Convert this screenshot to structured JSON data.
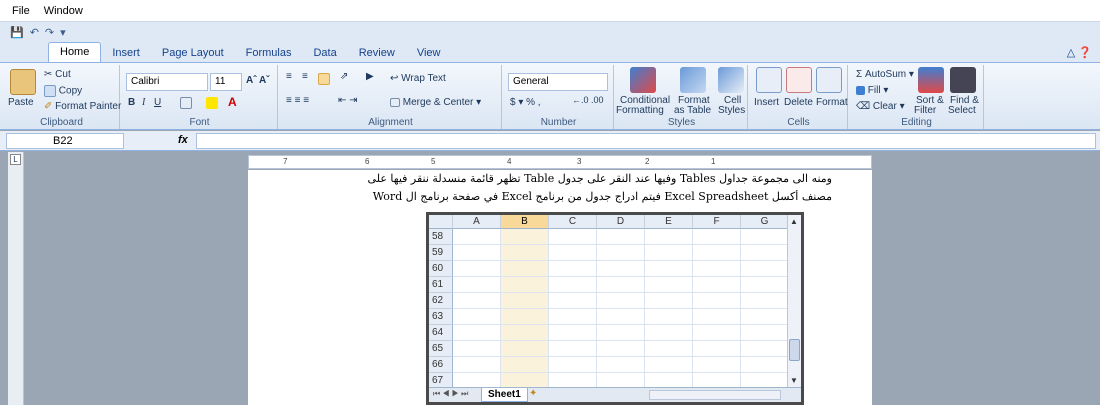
{
  "menu": {
    "items": [
      "File",
      "Window"
    ]
  },
  "ribbon": {
    "tabs": [
      "Home",
      "Insert",
      "Page Layout",
      "Formulas",
      "Data",
      "Review",
      "View"
    ],
    "active_tab": "Home",
    "clipboard": {
      "paste": "Paste",
      "cut": "Cut",
      "copy": "Copy",
      "format_painter": "Format Painter",
      "label": "Clipboard"
    },
    "font": {
      "name": "Calibri",
      "size": "11",
      "label": "Font"
    },
    "alignment": {
      "wrap": "Wrap Text",
      "merge": "Merge & Center",
      "label": "Alignment"
    },
    "number": {
      "format": "General",
      "label": "Number"
    },
    "styles": {
      "conditional": "Conditional",
      "conditional2": "Formatting",
      "format_as": "Format",
      "format_as2": "as Table",
      "cell": "Cell",
      "cell2": "Styles",
      "label": "Styles"
    },
    "cells": {
      "insert": "Insert",
      "delete": "Delete",
      "format": "Format",
      "label": "Cells"
    },
    "editing": {
      "autosum": "AutoSum",
      "fill": "Fill",
      "clear": "Clear",
      "sort": "Sort &",
      "sort2": "Filter",
      "find": "Find &",
      "find2": "Select",
      "label": "Editing"
    }
  },
  "formula_bar": {
    "namebox": "B22",
    "fx": "fx",
    "value": ""
  },
  "document": {
    "line1": "ومنه الى مجموعة جداول Tables وفيها عند النقر على جدول Table تظهر قائمة منسدلة ننقر فيها على",
    "line2": "مصنف أكسل Excel Spreadsheet فيتم ادراج جدول من برنامج Excel في صفحة برنامج ال Word"
  },
  "ruler": {
    "marks": [
      "7",
      "6",
      "5",
      "4",
      "3",
      "2",
      "1"
    ]
  },
  "spreadsheet": {
    "columns": [
      "A",
      "B",
      "C",
      "D",
      "E",
      "F",
      "G"
    ],
    "selected_column": "B",
    "rows": [
      "58",
      "59",
      "60",
      "61",
      "62",
      "63",
      "64",
      "65",
      "66",
      "67"
    ],
    "sheet_tab": "Sheet1"
  }
}
